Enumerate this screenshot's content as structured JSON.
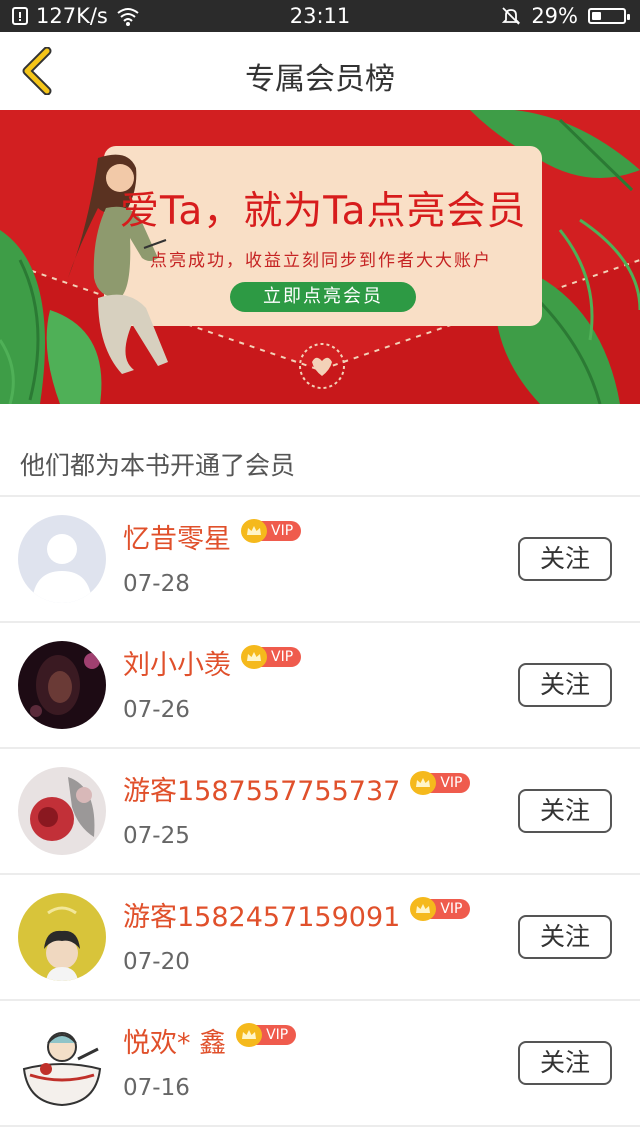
{
  "status_bar": {
    "speed": "127K/s",
    "time": "23:11",
    "battery": "29%",
    "battery_level": 0.29,
    "icons": [
      "notification-icon",
      "wifi-icon",
      "mute-bell-icon",
      "battery-icon"
    ]
  },
  "header": {
    "title": "专属会员榜",
    "back_icon": "chevron-left-icon"
  },
  "banner": {
    "headline": "爱Ta，就为Ta点亮会员",
    "subline": "点亮成功，收益立刻同步到作者大大账户",
    "cta": "立即点亮会员"
  },
  "section": {
    "title": "他们都为本书开通了会员"
  },
  "colors": {
    "accent_name": "#e0502b",
    "banner_red": "#d21f21",
    "vip_badge": "#ef5b4d",
    "crown": "#f5b91c",
    "cta_green": "#2d9a44"
  },
  "members": [
    {
      "name": "忆昔零星",
      "vip": "VIP",
      "date": "07-28",
      "follow": "关注"
    },
    {
      "name": "刘小小羡",
      "vip": "VIP",
      "date": "07-26",
      "follow": "关注"
    },
    {
      "name": "游客1587557755737",
      "vip": "VIP",
      "date": "07-25",
      "follow": "关注"
    },
    {
      "name": "游客1582457159091",
      "vip": "VIP",
      "date": "07-20",
      "follow": "关注"
    },
    {
      "name": "悦欢* 鑫",
      "vip": "VIP",
      "date": "07-16",
      "follow": "关注"
    }
  ]
}
